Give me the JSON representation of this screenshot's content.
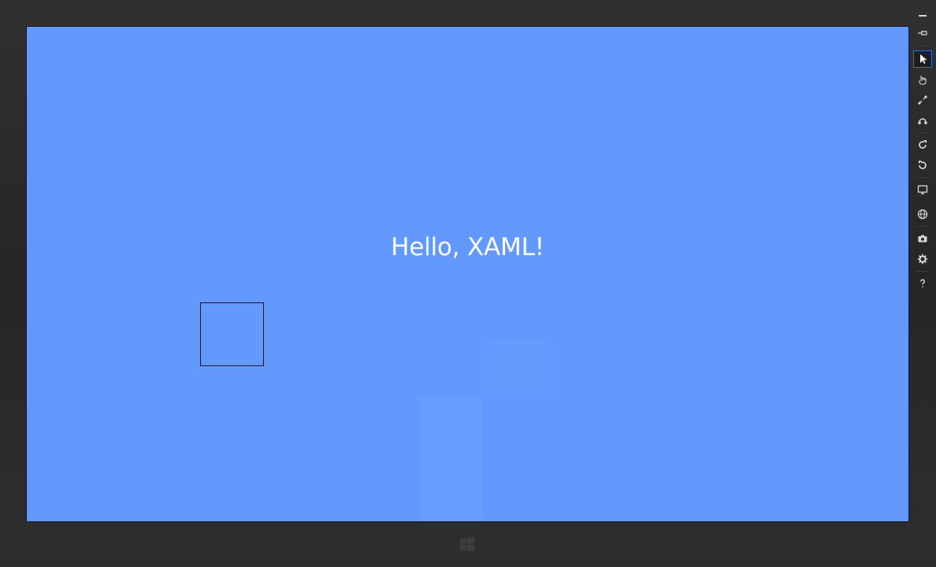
{
  "app": {
    "greeting": "Hello, XAML!"
  },
  "colors": {
    "screen_background": "#6399fd",
    "greeting_text": "#ffffff",
    "square_border": "#0b1a50",
    "bezel": "#2a2a2a",
    "toolbar_icon": "#d8d8d8",
    "active_tool_border": "#2f6fd6"
  },
  "simulator_toolbar": {
    "items": [
      {
        "icon": "minimize-icon"
      },
      {
        "icon": "pin-icon"
      },
      {
        "icon": "mouse-mode-icon",
        "active": true
      },
      {
        "icon": "touch-mode-icon"
      },
      {
        "icon": "pinch-zoom-icon"
      },
      {
        "icon": "rotation-touch-icon"
      },
      {
        "icon": "rotate-clockwise-icon"
      },
      {
        "icon": "rotate-counterclockwise-icon"
      },
      {
        "icon": "change-resolution-icon"
      },
      {
        "icon": "set-location-icon"
      },
      {
        "icon": "screenshot-icon"
      },
      {
        "icon": "settings-icon"
      },
      {
        "icon": "help-icon"
      }
    ]
  },
  "hardware": {
    "windows_button_icon": "windows-logo-icon"
  }
}
